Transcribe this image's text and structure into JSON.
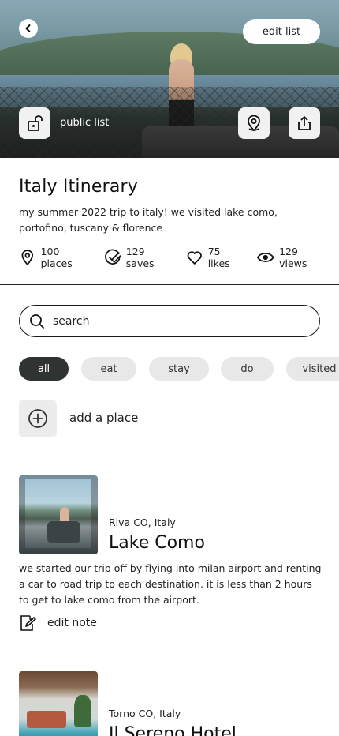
{
  "header": {
    "edit_list_label": "edit list",
    "public_list_label": "public list"
  },
  "list": {
    "title": "Italy Itinerary",
    "description": "my summer 2022 trip to italy! we visited lake como, portofino, tuscany & florence",
    "stats": {
      "places": "100 places",
      "saves": "129 saves",
      "likes": "75 likes",
      "views": "129 views"
    }
  },
  "search": {
    "placeholder": "search"
  },
  "filters": [
    {
      "label": "all",
      "active": true
    },
    {
      "label": "eat",
      "active": false
    },
    {
      "label": "stay",
      "active": false
    },
    {
      "label": "do",
      "active": false
    },
    {
      "label": "visited",
      "active": false
    }
  ],
  "add_place": {
    "label": "add a place"
  },
  "places": [
    {
      "location": "Riva CO, Italy",
      "name": "Lake Como",
      "note": "we started our trip off by flying into milan airport and renting a car to road trip to each destination. it is less than 2 hours to get to lake como from the airport.",
      "edit_note_label": "edit note"
    },
    {
      "location": "Torno CO, Italy",
      "name": "Il Sereno Hotel"
    }
  ],
  "colors": {
    "active_chip": "#2f3432",
    "chip": "#e8e8e8",
    "divider": "#222222"
  },
  "icons": [
    "back-arrow-icon",
    "unlock-icon",
    "map-pin-icon",
    "share-icon",
    "pin-icon",
    "saves-check-icon",
    "heart-icon",
    "eye-icon",
    "search-icon",
    "plus-circle-icon",
    "edit-note-icon"
  ]
}
